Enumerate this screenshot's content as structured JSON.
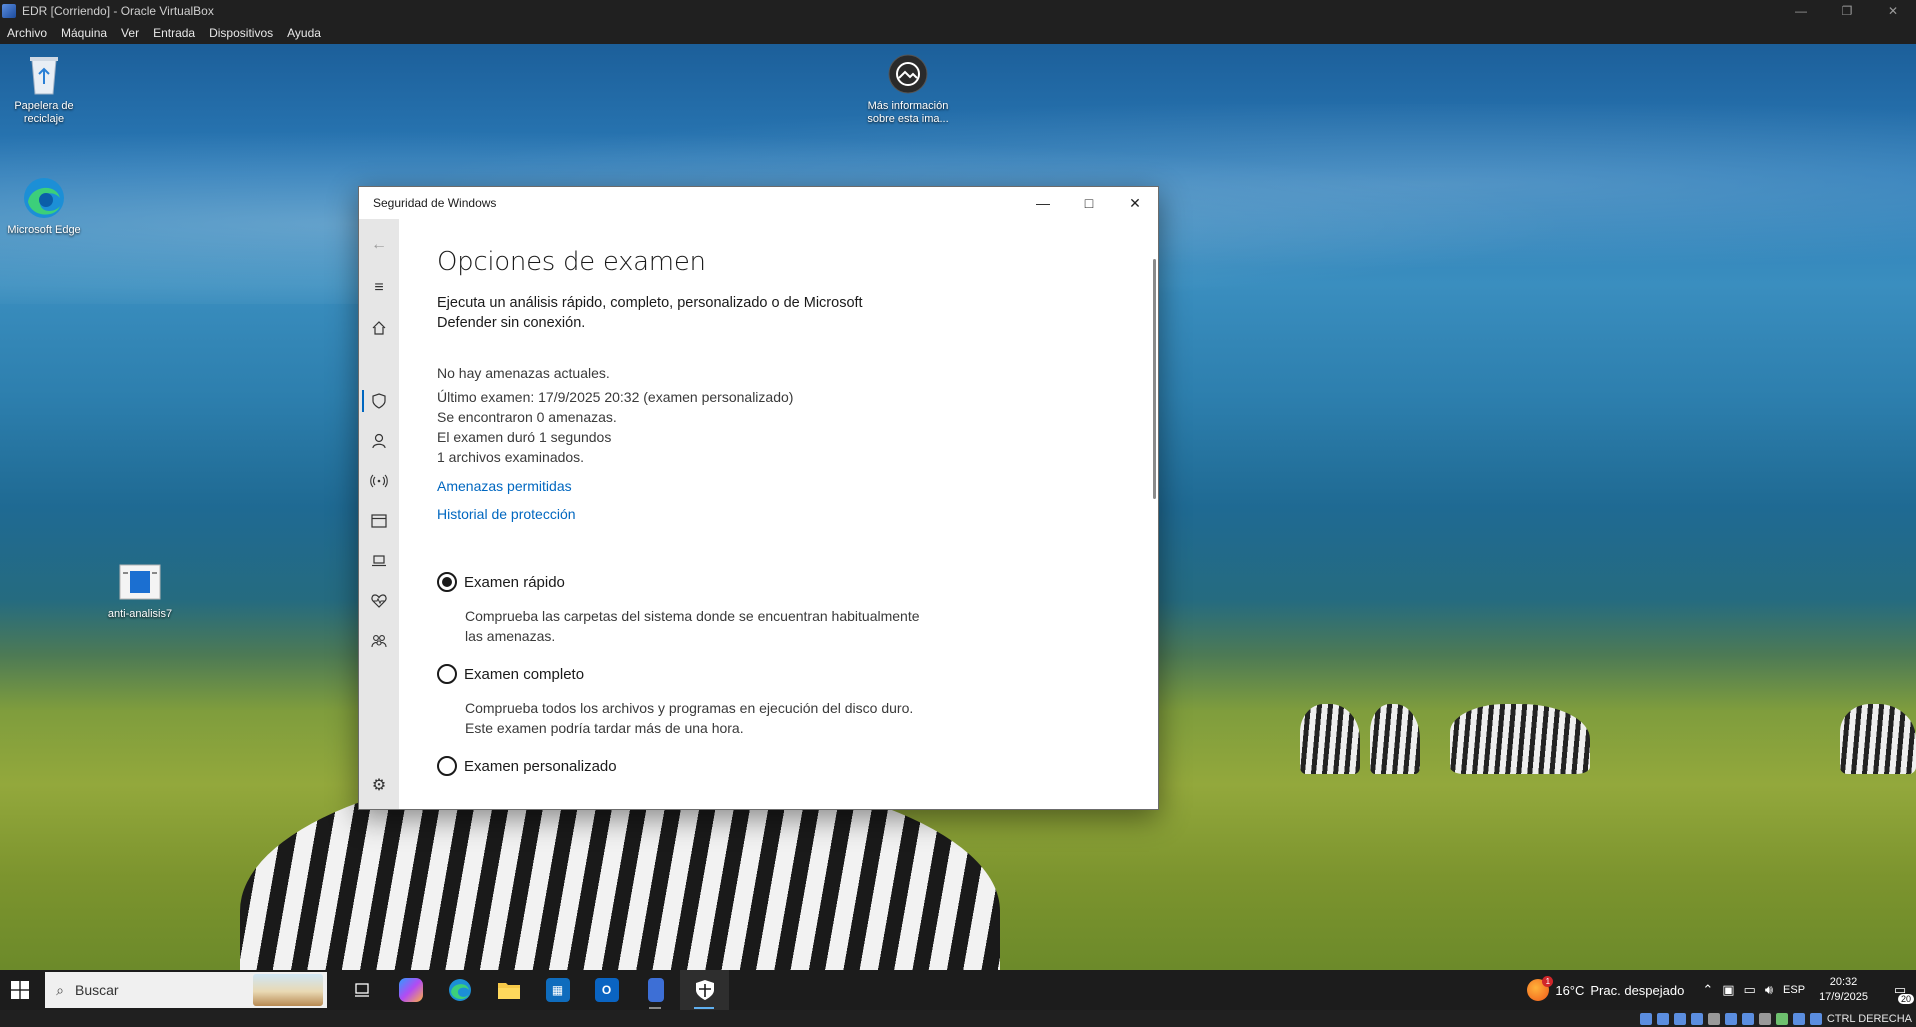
{
  "host": {
    "title": "EDR [Corriendo] - Oracle VirtualBox",
    "menu": [
      "Archivo",
      "Máquina",
      "Ver",
      "Entrada",
      "Dispositivos",
      "Ayuda"
    ],
    "host_key": "CTRL DERECHA"
  },
  "desktop": {
    "icons": {
      "recycle": "Papelera de reciclaje",
      "info": "Más información sobre esta ima...",
      "edge": "Microsoft Edge",
      "file": "anti-analisis7"
    }
  },
  "window": {
    "title": "Seguridad de Windows",
    "heading": "Opciones de examen",
    "description": "Ejecuta un análisis rápido, completo, personalizado o de Microsoft Defender sin conexión.",
    "status": {
      "no_threats": "No hay amenazas actuales.",
      "last_scan": "Último examen: 17/9/2025 20:32 (examen personalizado)",
      "found": "Se encontraron 0 amenazas.",
      "duration": "El examen duró 1 segundos",
      "files": "1 archivos examinados."
    },
    "links": {
      "allowed": "Amenazas permitidas",
      "history": "Historial de protección"
    },
    "options": [
      {
        "label": "Examen rápido",
        "description": "Comprueba las carpetas del sistema donde se encuentran habitualmente las amenazas.",
        "selected": true
      },
      {
        "label": "Examen completo",
        "description": "Comprueba todos los archivos y programas en ejecución del disco duro. Este examen podría tardar más de una hora.",
        "selected": false
      },
      {
        "label": "Examen personalizado",
        "selected": false
      }
    ]
  },
  "taskbar": {
    "search_placeholder": "Buscar",
    "weather": {
      "temp": "16°C",
      "condition": "Prac. despejado",
      "badge": "1"
    },
    "language": "ESP",
    "time": "20:32",
    "date": "17/9/2025",
    "notifications": "20"
  },
  "colors": {
    "accent": "#0067c0",
    "taskbar": "#1c1c1c",
    "nav": "#e6e6e6"
  }
}
